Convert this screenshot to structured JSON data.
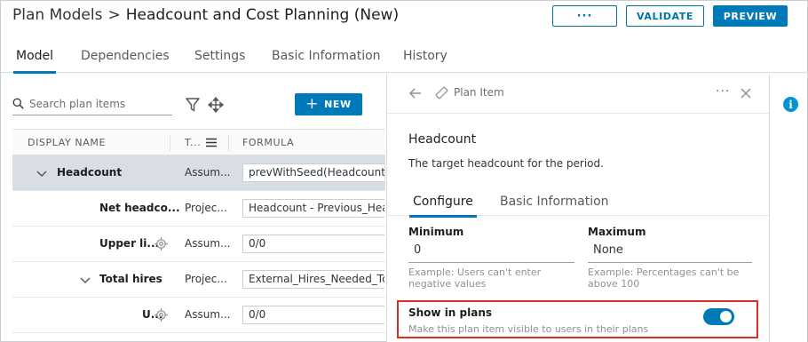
{
  "header": {
    "breadcrumb_parent": "Plan Models",
    "breadcrumb_sep": ">",
    "title": "Headcount and Cost Planning (New)",
    "more_label": "···",
    "validate_label": "VALIDATE",
    "preview_label": "PREVIEW"
  },
  "tabs": [
    {
      "label": "Model",
      "active": true
    },
    {
      "label": "Dependencies"
    },
    {
      "label": "Settings"
    },
    {
      "label": "Basic Information"
    },
    {
      "label": "History"
    }
  ],
  "toolbar": {
    "search_placeholder": "Search plan items",
    "new_label": "NEW",
    "new_icon": "+"
  },
  "grid": {
    "columns": [
      "DISPLAY NAME",
      "T...",
      "FORMULA"
    ],
    "rows": [
      {
        "name": "Headcount",
        "type": "Assum...",
        "formula": "prevWithSeed(Headcount_",
        "expanded": true,
        "selected": true
      },
      {
        "name": "Net headco...",
        "type": "Projec...",
        "formula": "Headcount - Previous_Hea"
      },
      {
        "name": "Upper li...",
        "type": "Assum...",
        "formula": "0/0",
        "has_target_icon": true
      },
      {
        "name": "Total hires",
        "type": "Projec...",
        "formula": "External_Hires_Needed_Tc",
        "expanded": true
      },
      {
        "name": "U...",
        "type": "Assum...",
        "formula": "0/0",
        "has_target_icon": true
      }
    ]
  },
  "panel": {
    "header_label": "Plan Item",
    "more_label": "···",
    "item_name": "Headcount",
    "item_desc": "The target headcount for the period.",
    "tabs": [
      {
        "label": "Configure",
        "active": true
      },
      {
        "label": "Basic Information"
      }
    ],
    "minimum": {
      "label": "Minimum",
      "value": "0",
      "help1": "Example: Users can't enter",
      "help2": "negative values"
    },
    "maximum": {
      "label": "Maximum",
      "value": "None",
      "help1": "Example: Percentages can't be",
      "help2": "above 100"
    },
    "show_in_plans": {
      "label": "Show in plans",
      "help": "Make this plan item visible to users in their plans",
      "enabled": true
    }
  },
  "colors": {
    "accent": "#0079b8",
    "highlight": "#d93025",
    "selected_row": "#d8dee3",
    "info": "#0094d3"
  }
}
